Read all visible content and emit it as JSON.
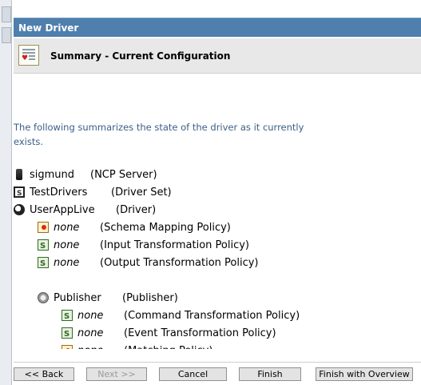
{
  "window": {
    "title": "New Driver"
  },
  "summary": {
    "title": "Summary - Current Configuration"
  },
  "intro": {
    "text": "The following summarizes the state of the driver as it currently exists."
  },
  "tree": [
    {
      "icon": "server-icon",
      "label": "sigmund",
      "type": "(NCP Server)"
    },
    {
      "icon": "driver-set-icon",
      "label": "TestDrivers",
      "type": "(Driver Set)"
    },
    {
      "icon": "driver-icon",
      "label": "UserAppLive",
      "type": "(Driver)"
    },
    {
      "icon": "schema-policy-icon",
      "label": "none",
      "type": "(Schema Mapping Policy)"
    },
    {
      "icon": "policy-icon",
      "label": "none",
      "type": "(Input Transformation Policy)"
    },
    {
      "icon": "policy-icon",
      "label": "none",
      "type": "(Output Transformation Policy)"
    },
    {
      "icon": "publisher-icon",
      "label": "Publisher",
      "type": "(Publisher)"
    },
    {
      "icon": "policy-icon",
      "label": "none",
      "type": "(Command Transformation Policy)"
    },
    {
      "icon": "policy-icon",
      "label": "none",
      "type": "(Event Transformation Policy)"
    },
    {
      "icon": "matching-policy-icon",
      "label": "none",
      "type": "(Matching Policy)"
    }
  ],
  "buttons": {
    "back": "<< Back",
    "next": "Next >>",
    "cancel": "Cancel",
    "finish": "Finish",
    "finish_overview": "Finish with Overview"
  },
  "colors": {
    "titlebar": "#4e7fad",
    "intro_text": "#3a5f86",
    "summary_bar": "#e8e8e8"
  }
}
